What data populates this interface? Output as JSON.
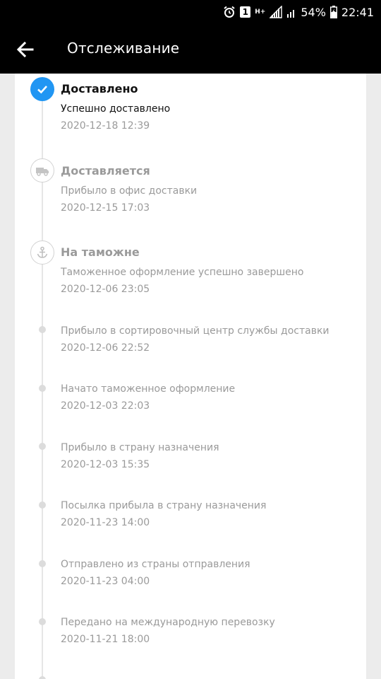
{
  "status_bar": {
    "notification_count": "1",
    "network_type": "H+",
    "battery_percent": "54%",
    "time": "22:41"
  },
  "app_bar": {
    "title": "Отслеживание"
  },
  "colors": {
    "accent": "#2196f3",
    "app_bar_bg": "#000000",
    "muted_text": "#9a9a9a"
  },
  "timeline": {
    "milestones": [
      {
        "title": "Доставлено",
        "description": "Успешно доставлено",
        "date": "2020-12-18 12:39",
        "icon": "check-icon",
        "state": "completed"
      },
      {
        "title": "Доставляется",
        "description": "Прибыло в офис доставки",
        "date": "2020-12-15 17:03",
        "icon": "truck-icon",
        "state": "past"
      },
      {
        "title": "На таможне",
        "description": "Таможенное оформление успешно завершено",
        "date": "2020-12-06 23:05",
        "icon": "anchor-icon",
        "state": "past"
      }
    ],
    "events": [
      {
        "description": "Прибыло в сортировочный центр службы доставки",
        "date": "2020-12-06 22:52"
      },
      {
        "description": "Начато таможенное оформление",
        "date": "2020-12-03 22:03"
      },
      {
        "description": "Прибыло в страну назначения",
        "date": "2020-12-03 15:35"
      },
      {
        "description": "Посылка прибыла в страну назначения",
        "date": "2020-11-23 14:00"
      },
      {
        "description": "Отправлено из страны отправления",
        "date": "2020-11-23 04:00"
      },
      {
        "description": "Передано на международную перевозку",
        "date": "2020-11-21 18:00"
      }
    ]
  }
}
